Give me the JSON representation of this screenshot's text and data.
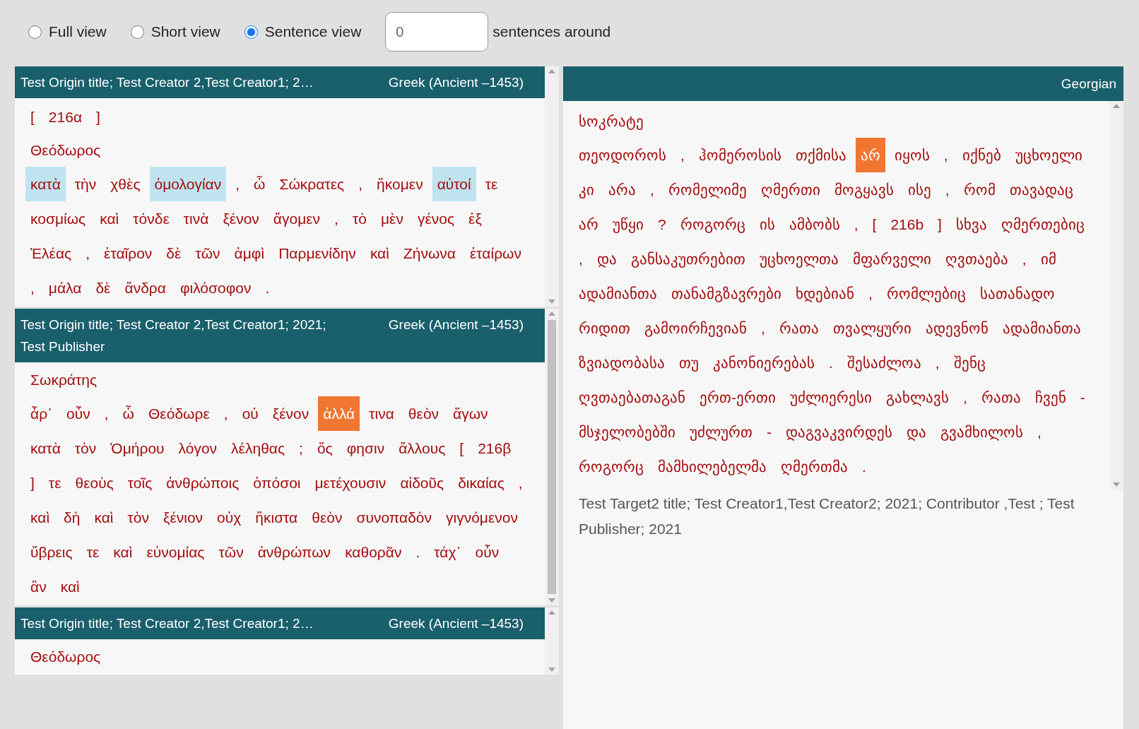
{
  "view_options": [
    {
      "label": "Full view",
      "selected": false
    },
    {
      "label": "Short view",
      "selected": false
    },
    {
      "label": "Sentence view",
      "selected": true
    }
  ],
  "context_field": {
    "value": "0",
    "label": "sentences around"
  },
  "source_panels": [
    {
      "title": "Test Origin title; Test Creator 2,Test Creator1; 2…",
      "language": "Greek (Ancient –1453)",
      "blocks": [
        {
          "kind": "tokens",
          "tokens": [
            {
              "text": "[",
              "kind": "plain"
            },
            {
              "text": "216α",
              "kind": "plain"
            },
            {
              "text": "]",
              "kind": "plain"
            }
          ]
        },
        {
          "kind": "speaker",
          "text": "Θεόδωρος"
        },
        {
          "kind": "tokens",
          "tokens": [
            {
              "text": "κατὰ",
              "kind": "match"
            },
            {
              "text": "τὴν",
              "kind": "plain"
            },
            {
              "text": "χθὲς",
              "kind": "plain"
            },
            {
              "text": "ὁμολογίαν",
              "kind": "match"
            },
            {
              "text": ",",
              "kind": "plain"
            },
            {
              "text": "ὦ",
              "kind": "plain"
            },
            {
              "text": "Σώκρατες",
              "kind": "plain"
            },
            {
              "text": ",",
              "kind": "plain"
            },
            {
              "text": "ἥκομεν",
              "kind": "plain"
            },
            {
              "text": "αὐτοί",
              "kind": "match"
            },
            {
              "text": "τε",
              "kind": "plain"
            },
            {
              "text": "κοσμίως",
              "kind": "plain"
            },
            {
              "text": "καὶ",
              "kind": "plain"
            },
            {
              "text": "τόνδε",
              "kind": "plain"
            },
            {
              "text": "τινὰ",
              "kind": "plain"
            },
            {
              "text": "ξένον",
              "kind": "plain"
            },
            {
              "text": "ἄγομεν",
              "kind": "plain"
            },
            {
              "text": ",",
              "kind": "plain"
            },
            {
              "text": "τὸ",
              "kind": "plain"
            },
            {
              "text": "μὲν",
              "kind": "plain"
            },
            {
              "text": "γένος",
              "kind": "plain"
            },
            {
              "text": "ἐξ",
              "kind": "plain"
            },
            {
              "text": "Ἐλέας",
              "kind": "plain"
            },
            {
              "text": ",",
              "kind": "plain"
            },
            {
              "text": "ἑταῖρον",
              "kind": "plain"
            },
            {
              "text": "δὲ",
              "kind": "plain"
            },
            {
              "text": "τῶν",
              "kind": "plain"
            },
            {
              "text": "ἀμφὶ",
              "kind": "plain"
            },
            {
              "text": "Παρμενίδην",
              "kind": "plain"
            },
            {
              "text": "καὶ",
              "kind": "plain"
            },
            {
              "text": "Ζήνωνα",
              "kind": "plain"
            },
            {
              "text": "ἑταίρων",
              "kind": "plain"
            },
            {
              "text": ",",
              "kind": "plain"
            },
            {
              "text": "μάλα",
              "kind": "plain"
            },
            {
              "text": "δὲ",
              "kind": "plain"
            },
            {
              "text": "ἄνδρα",
              "kind": "plain"
            },
            {
              "text": "φιλόσοφον",
              "kind": "plain"
            },
            {
              "text": ".",
              "kind": "plain"
            }
          ]
        }
      ]
    },
    {
      "title": "Test Origin title; Test Creator 2,Test Creator1; 2021; Test Publisher",
      "language": "Greek (Ancient –1453)",
      "blocks": [
        {
          "kind": "speaker",
          "text": "Σωκράτης"
        },
        {
          "kind": "tokens",
          "tokens": [
            {
              "text": "ἆρ᾽",
              "kind": "plain"
            },
            {
              "text": "οὖν",
              "kind": "plain"
            },
            {
              "text": ",",
              "kind": "plain"
            },
            {
              "text": "ὦ",
              "kind": "plain"
            },
            {
              "text": "Θεόδωρε",
              "kind": "plain"
            },
            {
              "text": ",",
              "kind": "plain"
            },
            {
              "text": "οὐ",
              "kind": "plain"
            },
            {
              "text": "ξένον",
              "kind": "plain"
            },
            {
              "text": "ἀλλά",
              "kind": "focus"
            },
            {
              "text": "τινα",
              "kind": "plain"
            },
            {
              "text": "θεὸν",
              "kind": "plain"
            },
            {
              "text": "ἄγων",
              "kind": "plain"
            },
            {
              "text": "κατὰ",
              "kind": "plain"
            },
            {
              "text": "τὸν",
              "kind": "plain"
            },
            {
              "text": "Ὁμήρου",
              "kind": "plain"
            },
            {
              "text": "λόγον",
              "kind": "plain"
            },
            {
              "text": "λέληθας",
              "kind": "plain"
            },
            {
              "text": ";",
              "kind": "plain"
            },
            {
              "text": "ὅς",
              "kind": "plain"
            },
            {
              "text": "φησιν",
              "kind": "plain"
            },
            {
              "text": "ἄλλους",
              "kind": "plain"
            },
            {
              "text": "[",
              "kind": "plain"
            },
            {
              "text": "216β",
              "kind": "plain"
            },
            {
              "text": "]",
              "kind": "plain"
            },
            {
              "text": "τε",
              "kind": "plain"
            },
            {
              "text": "θεοὺς",
              "kind": "plain"
            },
            {
              "text": "τοῖς",
              "kind": "plain"
            },
            {
              "text": "ἀνθρώποις",
              "kind": "plain"
            },
            {
              "text": "ὁπόσοι",
              "kind": "plain"
            },
            {
              "text": "μετέχουσιν",
              "kind": "plain"
            },
            {
              "text": "αἰδοῦς",
              "kind": "plain"
            },
            {
              "text": "δικαίας",
              "kind": "plain"
            },
            {
              "text": ",",
              "kind": "plain"
            },
            {
              "text": "καὶ",
              "kind": "plain"
            },
            {
              "text": "δὴ",
              "kind": "plain"
            },
            {
              "text": "καὶ",
              "kind": "plain"
            },
            {
              "text": "τὸν",
              "kind": "plain"
            },
            {
              "text": "ξένιον",
              "kind": "plain"
            },
            {
              "text": "οὐχ",
              "kind": "plain"
            },
            {
              "text": "ἥκιστα",
              "kind": "plain"
            },
            {
              "text": "θεὸν",
              "kind": "plain"
            },
            {
              "text": "συνοπαδὸν",
              "kind": "plain"
            },
            {
              "text": "γιγνόμενον",
              "kind": "plain"
            },
            {
              "text": "ὕβρεις",
              "kind": "plain"
            },
            {
              "text": "τε",
              "kind": "plain"
            },
            {
              "text": "καὶ",
              "kind": "plain"
            },
            {
              "text": "εὐνομίας",
              "kind": "plain"
            },
            {
              "text": "τῶν",
              "kind": "plain"
            },
            {
              "text": "ἀνθρώπων",
              "kind": "plain"
            },
            {
              "text": "καθορᾶν",
              "kind": "plain"
            },
            {
              "text": ".",
              "kind": "plain"
            },
            {
              "text": "τάχ᾽",
              "kind": "plain"
            },
            {
              "text": "οὖν",
              "kind": "plain"
            },
            {
              "text": "ἂν",
              "kind": "plain"
            },
            {
              "text": "καὶ",
              "kind": "plain"
            }
          ]
        }
      ]
    },
    {
      "title": "Test Origin title; Test Creator 2,Test Creator1; 2…",
      "language": "Greek (Ancient –1453)",
      "blocks": [
        {
          "kind": "speaker",
          "text": "Θεόδωρος"
        }
      ]
    }
  ],
  "target_panel": {
    "language": "Georgian",
    "blocks": [
      {
        "kind": "speaker",
        "text": "სოკრატე"
      },
      {
        "kind": "tokens",
        "tokens": [
          {
            "text": "თეოდოროს",
            "kind": "plain"
          },
          {
            "text": ",",
            "kind": "plain"
          },
          {
            "text": "ჰომეროსის",
            "kind": "plain"
          },
          {
            "text": "თქმისა",
            "kind": "plain"
          },
          {
            "text": "არ",
            "kind": "focus"
          },
          {
            "text": "იყოს",
            "kind": "plain"
          },
          {
            "text": ",",
            "kind": "plain"
          },
          {
            "text": "იქნებ",
            "kind": "plain"
          },
          {
            "text": "უცხოელი",
            "kind": "plain"
          },
          {
            "text": "კი",
            "kind": "plain"
          },
          {
            "text": "არა",
            "kind": "plain"
          },
          {
            "text": ",",
            "kind": "plain"
          },
          {
            "text": "რომელიმე",
            "kind": "plain"
          },
          {
            "text": "ღმერთი",
            "kind": "plain"
          },
          {
            "text": "მოგყავს",
            "kind": "plain"
          },
          {
            "text": "ისე",
            "kind": "plain"
          },
          {
            "text": ",",
            "kind": "plain"
          },
          {
            "text": "რომ",
            "kind": "plain"
          },
          {
            "text": "თავადაც",
            "kind": "plain"
          },
          {
            "text": "არ",
            "kind": "plain"
          },
          {
            "text": "უწყი",
            "kind": "plain"
          },
          {
            "text": "?",
            "kind": "plain"
          },
          {
            "text": "როგორც",
            "kind": "plain"
          },
          {
            "text": "ის",
            "kind": "plain"
          },
          {
            "text": "ამბობს",
            "kind": "plain"
          },
          {
            "text": ",",
            "kind": "plain"
          },
          {
            "text": "[",
            "kind": "plain"
          },
          {
            "text": "216b",
            "kind": "plain"
          },
          {
            "text": "]",
            "kind": "plain"
          },
          {
            "text": "სხვა",
            "kind": "plain"
          },
          {
            "text": "ღმერთებიც",
            "kind": "plain"
          },
          {
            "text": ",",
            "kind": "plain"
          },
          {
            "text": "და",
            "kind": "plain"
          },
          {
            "text": "განსაკუთრებით",
            "kind": "plain"
          },
          {
            "text": "უცხოელთა",
            "kind": "plain"
          },
          {
            "text": "მფარველი",
            "kind": "plain"
          },
          {
            "text": "ღვთაება",
            "kind": "plain"
          },
          {
            "text": ",",
            "kind": "plain"
          },
          {
            "text": "იმ",
            "kind": "plain"
          },
          {
            "text": "ადამიანთა",
            "kind": "plain"
          },
          {
            "text": "თანამგზავრები",
            "kind": "plain"
          },
          {
            "text": "ხდებიან",
            "kind": "plain"
          },
          {
            "text": ",",
            "kind": "plain"
          },
          {
            "text": "რომლებიც",
            "kind": "plain"
          },
          {
            "text": "სათანადო",
            "kind": "plain"
          },
          {
            "text": "რიდით",
            "kind": "plain"
          },
          {
            "text": "გამოირჩევიან",
            "kind": "plain"
          },
          {
            "text": ",",
            "kind": "plain"
          },
          {
            "text": "რათა",
            "kind": "plain"
          },
          {
            "text": "თვალყური",
            "kind": "plain"
          },
          {
            "text": "ადევნონ",
            "kind": "plain"
          },
          {
            "text": "ადამიანთა",
            "kind": "plain"
          },
          {
            "text": "ზვიადობასა",
            "kind": "plain"
          },
          {
            "text": "თუ",
            "kind": "plain"
          },
          {
            "text": "კანონიერებას",
            "kind": "plain"
          },
          {
            "text": ".",
            "kind": "plain"
          },
          {
            "text": "შესაძლოა",
            "kind": "plain"
          },
          {
            "text": ",",
            "kind": "plain"
          },
          {
            "text": "შენც",
            "kind": "plain"
          },
          {
            "text": "ღვთაებათაგან",
            "kind": "plain"
          },
          {
            "text": "ერთ-ერთი",
            "kind": "plain"
          },
          {
            "text": "უძლიერესი",
            "kind": "plain"
          },
          {
            "text": "გახლავს",
            "kind": "plain"
          },
          {
            "text": ",",
            "kind": "plain"
          },
          {
            "text": "რათა",
            "kind": "plain"
          },
          {
            "text": "ჩვენ",
            "kind": "plain"
          },
          {
            "text": "-",
            "kind": "plain"
          },
          {
            "text": "მსჯელობებში",
            "kind": "plain"
          },
          {
            "text": "უძლურთ",
            "kind": "plain"
          },
          {
            "text": "-",
            "kind": "plain"
          },
          {
            "text": "დაგვაკვირდეს",
            "kind": "plain"
          },
          {
            "text": "და",
            "kind": "plain"
          },
          {
            "text": "გვამხილოს",
            "kind": "plain"
          },
          {
            "text": ",",
            "kind": "plain"
          },
          {
            "text": "როგორც",
            "kind": "plain"
          },
          {
            "text": "მამხილებელმა",
            "kind": "plain"
          },
          {
            "text": "ღმერთმა",
            "kind": "plain"
          },
          {
            "text": ".",
            "kind": "plain"
          }
        ]
      }
    ],
    "citation": "Test Target2 title; Test Creator1,Test Creator2; 2021; Contributor ,Test ; Test Publisher; 2021"
  }
}
